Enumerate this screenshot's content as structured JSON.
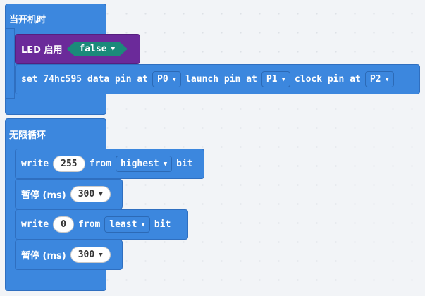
{
  "on_start": {
    "hat_label": "当开机时",
    "led": {
      "label": "LED 启用",
      "value": "false"
    },
    "set74": {
      "prefix": "set 74hc595 data pin at",
      "data_pin": "P0",
      "launch_label": "launch pin at",
      "launch_pin": "P1",
      "clock_label": "clock pin at",
      "clock_pin": "P2"
    }
  },
  "forever": {
    "hat_label": "无限循环",
    "write1": {
      "label": "write",
      "value": "255",
      "from_label": "from",
      "order": "highest",
      "bit_label": "bit"
    },
    "pause1": {
      "label": "暂停 (ms)",
      "value": "300"
    },
    "write2": {
      "label": "write",
      "value": "0",
      "from_label": "from",
      "order": "least",
      "bit_label": "bit"
    },
    "pause2": {
      "label": "暂停 (ms)",
      "value": "300"
    }
  },
  "colors": {
    "basic_blue": "#3c87de",
    "led_purple": "#6b2a9a",
    "toggle_teal": "#1b8a7a",
    "workspace": "#f2f4f7"
  },
  "icons": {
    "dropdown": "▼"
  }
}
